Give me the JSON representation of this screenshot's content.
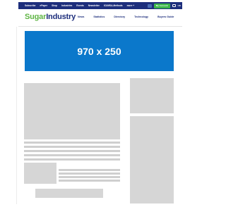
{
  "topbar": {
    "links": [
      "Subscribe",
      "ePaper",
      "Shop",
      "Industries",
      "Events",
      "Newsletter",
      "ICUMSA-Methods",
      "more +"
    ],
    "account_label": "My Account",
    "region_label": "UK",
    "colors": {
      "background": "#1d2e7c",
      "account": "#3bb54a"
    }
  },
  "header": {
    "logo_part1": "Sugar",
    "logo_part2": "Industry",
    "nav": [
      "News",
      "Statistics",
      "Directory",
      "Technology",
      "Buyers Guide"
    ],
    "colors": {
      "logo_green": "#5fb545",
      "logo_navy": "#1d2e7c"
    }
  },
  "banner": {
    "label": "970 x 250",
    "color": "#0b78cb"
  }
}
